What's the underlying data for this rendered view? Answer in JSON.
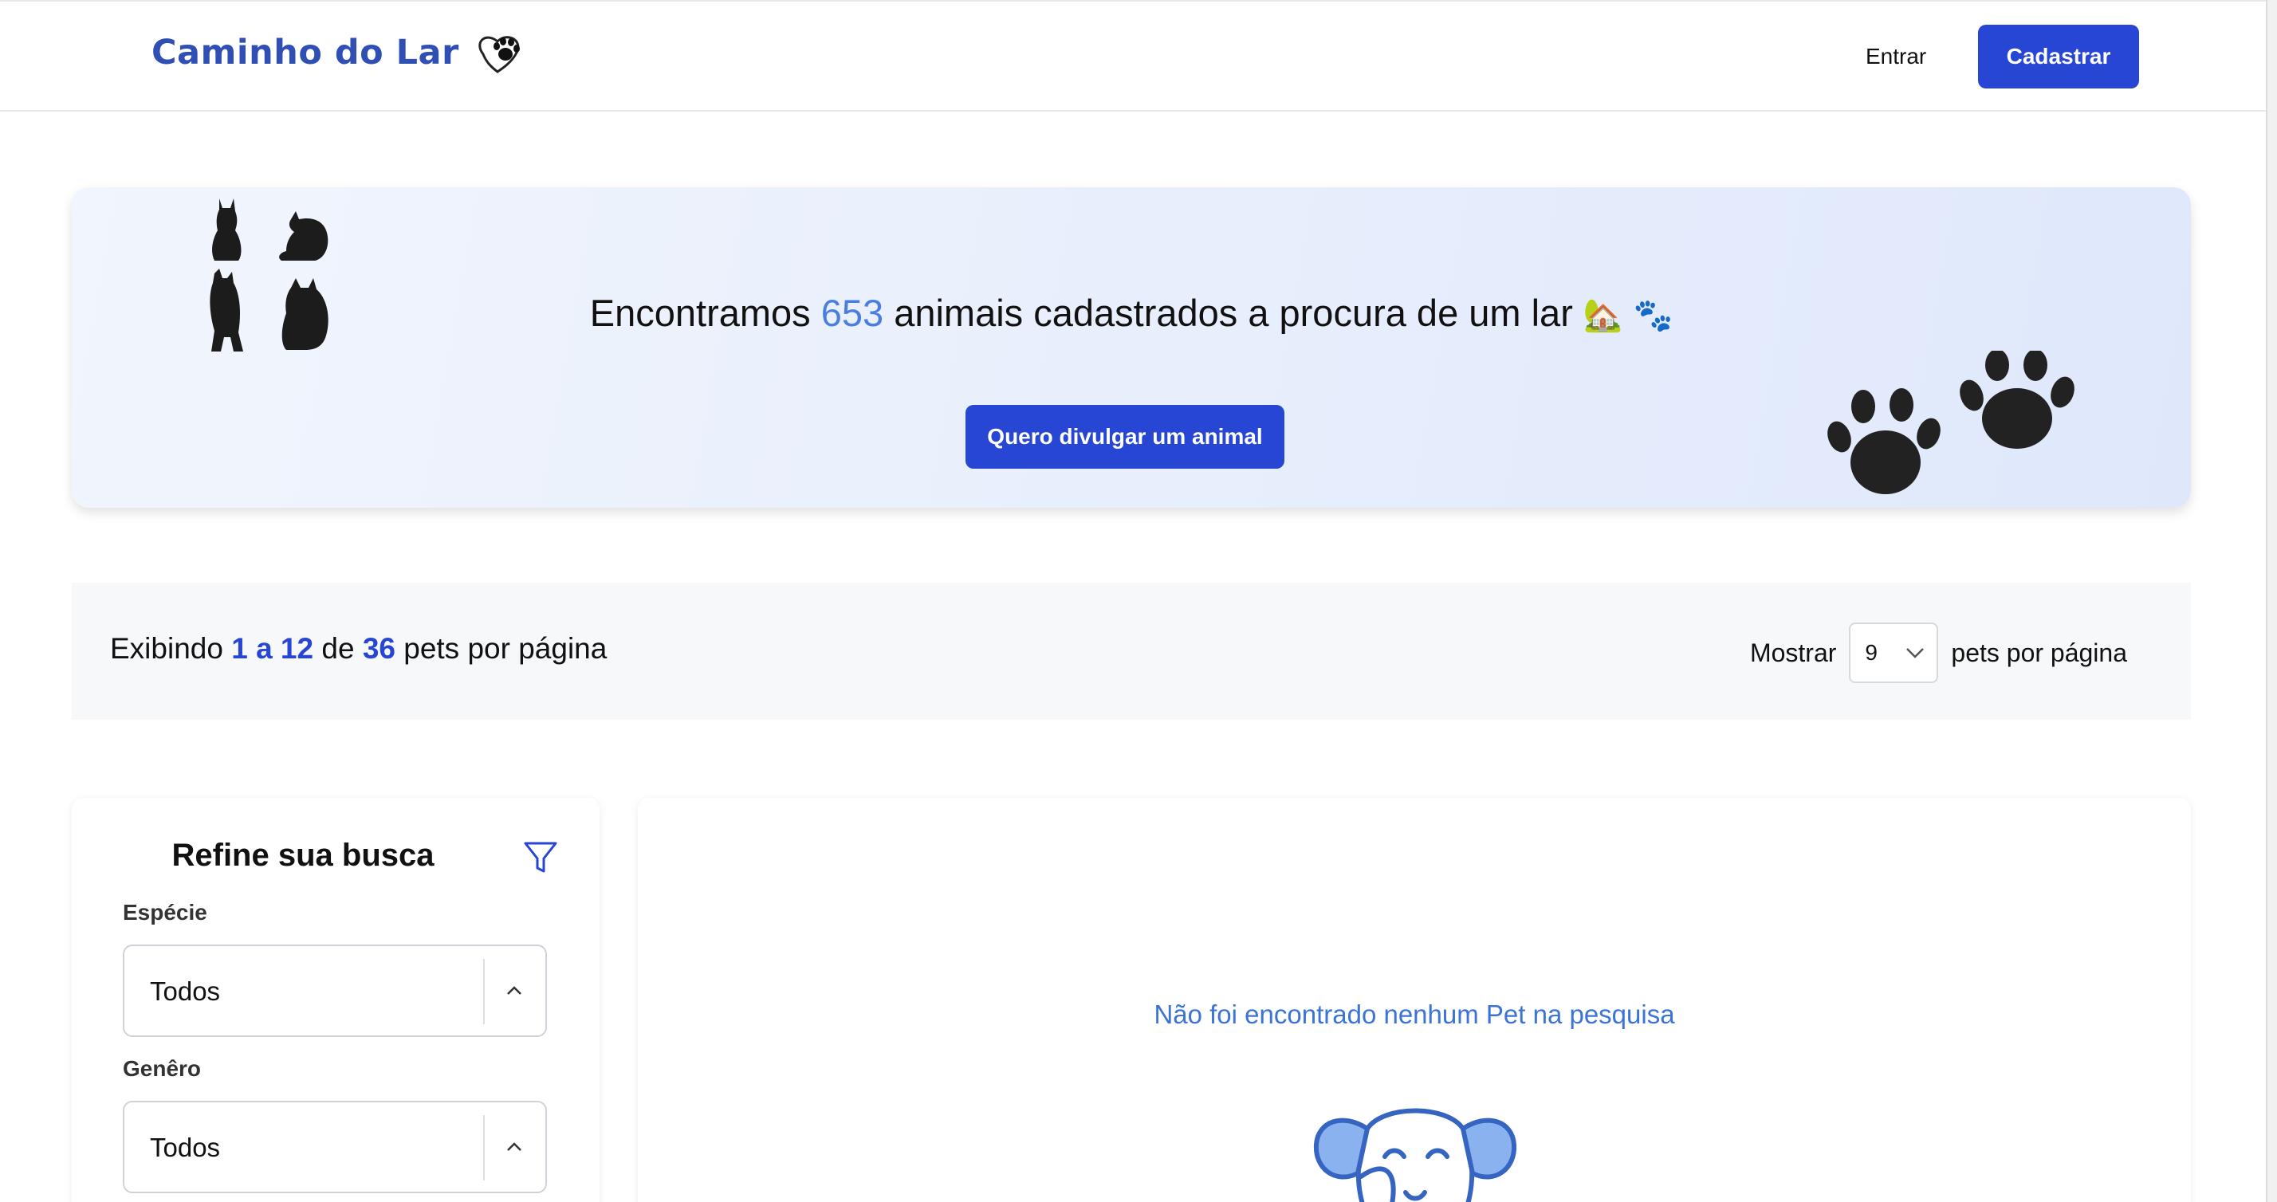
{
  "header": {
    "brand_name": "Caminho do Lar",
    "logo_icon": "heart-paw-icon",
    "login_label": "Entrar",
    "signup_label": "Cadastrar"
  },
  "hero": {
    "headline_prefix": "Encontramos",
    "pet_count": "653",
    "headline_suffix": "animais cadastrados a procura de um lar",
    "headline_emoji": "🏡 🐾",
    "cta_label": "Quero divulgar um animal",
    "decor_left": "cat-silhouettes-icon",
    "decor_right": "paw-prints-icon"
  },
  "results_bar": {
    "prefix": "Exibindo",
    "range": "1 a 12",
    "middle": "de",
    "total": "36",
    "suffix": "pets por página",
    "show_label": "Mostrar",
    "per_page_value": "9",
    "per_page_suffix": "pets por página"
  },
  "filters": {
    "title": "Refine sua busca",
    "filter_icon": "funnel-icon",
    "fields": [
      {
        "label": "Espécie",
        "value": "Todos"
      },
      {
        "label": "Genêro",
        "value": "Todos"
      }
    ]
  },
  "results": {
    "empty_message": "Não foi encontrado nenhum Pet na pesquisa",
    "empty_illustration": "dog-face-icon"
  },
  "colors": {
    "primary": "#2746d3",
    "brand_text": "#2f4fb4",
    "highlight_count": "#4a7ee0",
    "empty_text": "#3b74d6"
  }
}
